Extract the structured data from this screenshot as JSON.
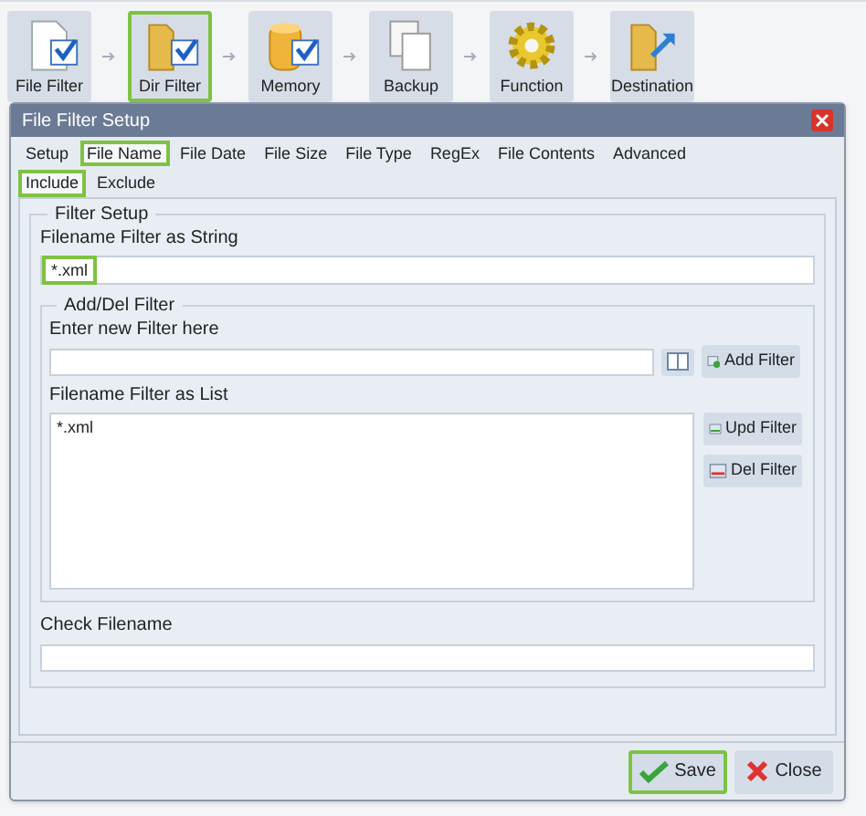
{
  "toolbar": [
    {
      "label": "File Filter",
      "highlighted": false
    },
    {
      "label": "Dir Filter",
      "highlighted": true
    },
    {
      "label": "Memory",
      "highlighted": false
    },
    {
      "label": "Backup",
      "highlighted": false
    },
    {
      "label": "Function",
      "highlighted": false
    },
    {
      "label": "Destination",
      "highlighted": false
    }
  ],
  "dialog": {
    "title": "File Filter Setup",
    "tabs": [
      {
        "label": "Setup",
        "selected": false
      },
      {
        "label": "File Name",
        "selected": true
      },
      {
        "label": "File Date",
        "selected": false
      },
      {
        "label": "File Size",
        "selected": false
      },
      {
        "label": "File Type",
        "selected": false
      },
      {
        "label": "RegEx",
        "selected": false
      },
      {
        "label": "File Contents",
        "selected": false
      },
      {
        "label": "Advanced",
        "selected": false
      }
    ],
    "subtabs": [
      {
        "label": "Include",
        "selected": true
      },
      {
        "label": "Exclude",
        "selected": false
      }
    ],
    "filter_setup": {
      "title": "Filter Setup",
      "string_label": "Filename Filter as String",
      "string_value": "*.xml",
      "string_highlighted": true,
      "add_del": {
        "title": "Add/Del Filter",
        "new_label": "Enter new Filter here",
        "list_label": "Filename Filter as List",
        "list_items": [
          "*.xml"
        ],
        "buttons": [
          {
            "label": "Add Filter",
            "kind": "add"
          },
          {
            "label": "Upd Filter",
            "kind": "update"
          },
          {
            "label": "Del Filter",
            "kind": "delete"
          }
        ]
      },
      "check_label": "Check Filename"
    },
    "buttons": [
      {
        "label": "Save",
        "kind": "save",
        "highlighted": true
      },
      {
        "label": "Close",
        "kind": "close",
        "highlighted": false
      }
    ]
  }
}
